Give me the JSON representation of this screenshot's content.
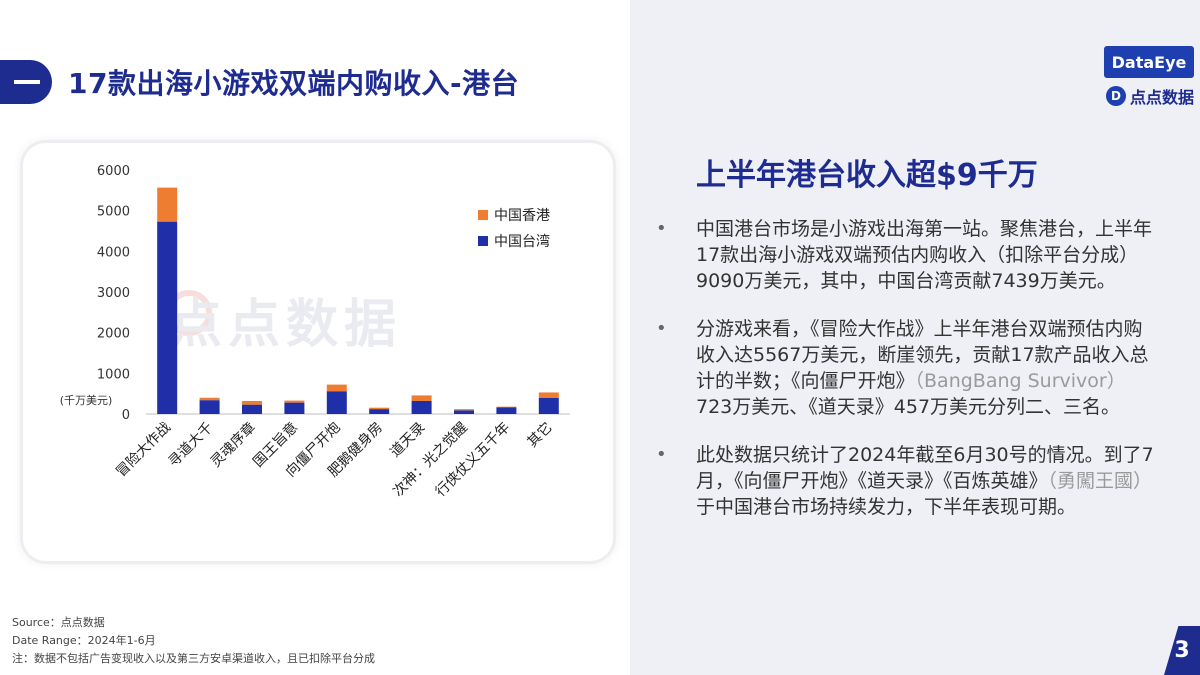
{
  "page": {
    "title": "17款出海小游戏双端内购收入-港台",
    "page_number": "3"
  },
  "logo": {
    "brand": "DataEye",
    "sub_mark": "D",
    "sub_text": "点点数据"
  },
  "watermark": "点点数据",
  "headline": "上半年港台收入超$9千万",
  "bullets": [
    {
      "dot": "•",
      "parts": [
        "中国港台市场是小游戏出海第一站。聚焦港台，上半年17款出海小游戏双端预估内购收入（扣除平台分成）9090万美元，其中，中国台湾贡献7439万美元。"
      ]
    },
    {
      "dot": "•",
      "parts": [
        "分游戏来看，《冒险大作战》上半年港台双端预估内购收入达5567万美元，断崖领先，贡献17款产品收入总计的半数；《向僵尸开炮》",
        "（BangBang Survivor）",
        "723万美元、《道天录》457万美元分列二、三名。"
      ]
    },
    {
      "dot": "•",
      "parts": [
        "此处数据只统计了2024年截至6月30号的情况。到了7月，《向僵尸开炮》《道天录》《百炼英雄》",
        "（勇闖王國）",
        "于中国港台市场持续发力，下半年表现可期。"
      ]
    }
  ],
  "footnotes": {
    "source": "Source：点点数据",
    "date_range": "Date Range：2024年1-6月",
    "note": "注：数据不包括广告变现收入以及第三方安卓渠道收入，且已扣除平台分成"
  },
  "colors": {
    "brand": "#1e2b8f",
    "taiwan": "#1f2fa8",
    "hongkong": "#ee7d31"
  },
  "chart_data": {
    "type": "bar",
    "stacked": true,
    "categories": [
      "冒险大作战",
      "寻道大千",
      "灵魂序章",
      "国王旨意",
      "向僵尸开炮",
      "肥鹅健身房",
      "道天录",
      "次神：光之觉醒",
      "行侠仗义五千年",
      "其它"
    ],
    "series": [
      {
        "name": "中国台湾",
        "color": "#1f2fa8",
        "values": [
          4730,
          340,
          230,
          280,
          560,
          120,
          320,
          90,
          160,
          400
        ]
      },
      {
        "name": "中国香港",
        "color": "#ee7d31",
        "values": [
          837,
          60,
          90,
          50,
          163,
          35,
          137,
          30,
          20,
          130
        ]
      }
    ],
    "unit_label": "(千万美元)",
    "ylim": [
      0,
      6000
    ],
    "yticks": [
      0,
      1000,
      2000,
      3000,
      4000,
      5000,
      6000
    ],
    "legend_position": "top-right",
    "grid": false
  }
}
